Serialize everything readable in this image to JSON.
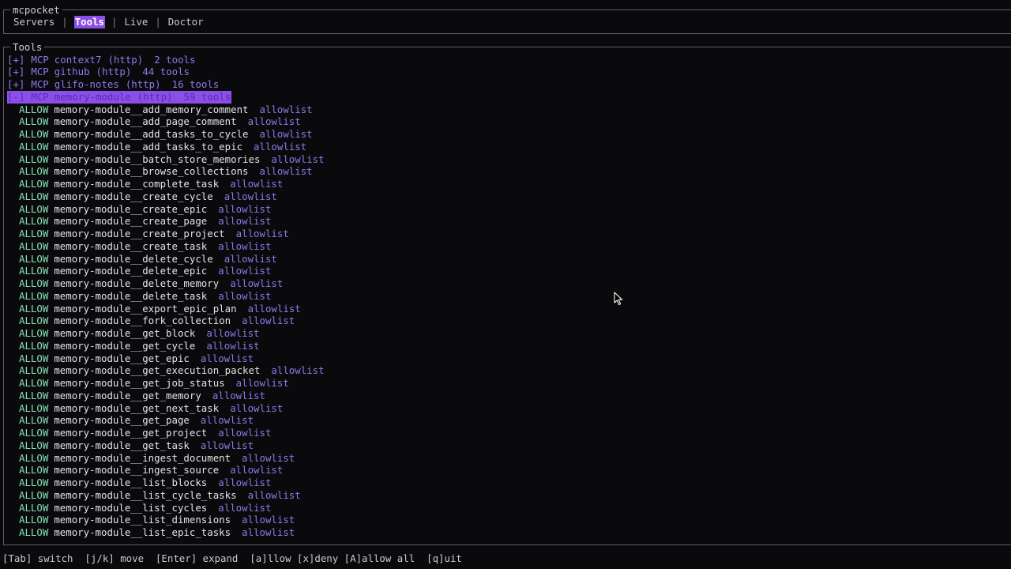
{
  "app": {
    "title": "mcpocket",
    "tabs": [
      {
        "label": "Servers",
        "active": false
      },
      {
        "label": "Tools",
        "active": true
      },
      {
        "label": "Live",
        "active": false
      },
      {
        "label": "Doctor",
        "active": false
      }
    ]
  },
  "panel": {
    "title": "Tools",
    "servers": [
      {
        "toggle": "[+]",
        "prefix": "MCP",
        "name": "context7",
        "kind": "(http)",
        "count": "2 tools"
      },
      {
        "toggle": "[+]",
        "prefix": "MCP",
        "name": "github",
        "kind": "(http)",
        "count": "44 tools"
      },
      {
        "toggle": "[+]",
        "prefix": "MCP",
        "name": "glifo-notes",
        "kind": "(http)",
        "count": "16 tools"
      },
      {
        "toggle": "[-]",
        "prefix": "MCP",
        "name": "memory-module",
        "kind": "(http)",
        "count": "59 tools",
        "selected": true
      }
    ],
    "tools": [
      {
        "status": "ALLOW",
        "name": "memory-module__add_memory_comment",
        "source": "allowlist"
      },
      {
        "status": "ALLOW",
        "name": "memory-module__add_page_comment",
        "source": "allowlist"
      },
      {
        "status": "ALLOW",
        "name": "memory-module__add_tasks_to_cycle",
        "source": "allowlist"
      },
      {
        "status": "ALLOW",
        "name": "memory-module__add_tasks_to_epic",
        "source": "allowlist"
      },
      {
        "status": "ALLOW",
        "name": "memory-module__batch_store_memories",
        "source": "allowlist"
      },
      {
        "status": "ALLOW",
        "name": "memory-module__browse_collections",
        "source": "allowlist"
      },
      {
        "status": "ALLOW",
        "name": "memory-module__complete_task",
        "source": "allowlist"
      },
      {
        "status": "ALLOW",
        "name": "memory-module__create_cycle",
        "source": "allowlist"
      },
      {
        "status": "ALLOW",
        "name": "memory-module__create_epic",
        "source": "allowlist"
      },
      {
        "status": "ALLOW",
        "name": "memory-module__create_page",
        "source": "allowlist"
      },
      {
        "status": "ALLOW",
        "name": "memory-module__create_project",
        "source": "allowlist"
      },
      {
        "status": "ALLOW",
        "name": "memory-module__create_task",
        "source": "allowlist"
      },
      {
        "status": "ALLOW",
        "name": "memory-module__delete_cycle",
        "source": "allowlist"
      },
      {
        "status": "ALLOW",
        "name": "memory-module__delete_epic",
        "source": "allowlist"
      },
      {
        "status": "ALLOW",
        "name": "memory-module__delete_memory",
        "source": "allowlist"
      },
      {
        "status": "ALLOW",
        "name": "memory-module__delete_task",
        "source": "allowlist"
      },
      {
        "status": "ALLOW",
        "name": "memory-module__export_epic_plan",
        "source": "allowlist"
      },
      {
        "status": "ALLOW",
        "name": "memory-module__fork_collection",
        "source": "allowlist"
      },
      {
        "status": "ALLOW",
        "name": "memory-module__get_block",
        "source": "allowlist"
      },
      {
        "status": "ALLOW",
        "name": "memory-module__get_cycle",
        "source": "allowlist"
      },
      {
        "status": "ALLOW",
        "name": "memory-module__get_epic",
        "source": "allowlist"
      },
      {
        "status": "ALLOW",
        "name": "memory-module__get_execution_packet",
        "source": "allowlist"
      },
      {
        "status": "ALLOW",
        "name": "memory-module__get_job_status",
        "source": "allowlist"
      },
      {
        "status": "ALLOW",
        "name": "memory-module__get_memory",
        "source": "allowlist"
      },
      {
        "status": "ALLOW",
        "name": "memory-module__get_next_task",
        "source": "allowlist"
      },
      {
        "status": "ALLOW",
        "name": "memory-module__get_page",
        "source": "allowlist"
      },
      {
        "status": "ALLOW",
        "name": "memory-module__get_project",
        "source": "allowlist"
      },
      {
        "status": "ALLOW",
        "name": "memory-module__get_task",
        "source": "allowlist"
      },
      {
        "status": "ALLOW",
        "name": "memory-module__ingest_document",
        "source": "allowlist"
      },
      {
        "status": "ALLOW",
        "name": "memory-module__ingest_source",
        "source": "allowlist"
      },
      {
        "status": "ALLOW",
        "name": "memory-module__list_blocks",
        "source": "allowlist"
      },
      {
        "status": "ALLOW",
        "name": "memory-module__list_cycle_tasks",
        "source": "allowlist"
      },
      {
        "status": "ALLOW",
        "name": "memory-module__list_cycles",
        "source": "allowlist"
      },
      {
        "status": "ALLOW",
        "name": "memory-module__list_dimensions",
        "source": "allowlist"
      },
      {
        "status": "ALLOW",
        "name": "memory-module__list_epic_tasks",
        "source": "allowlist"
      }
    ]
  },
  "footer": {
    "help": "[Tab] switch  [j/k] move  [Enter] expand  [a]llow [x]deny [A]allow all  [q]uit"
  },
  "colors": {
    "accent": "#8b4fe8",
    "allow": "#86e0b4",
    "muted_purple": "#8e78e8",
    "background": "#0a0a0c"
  }
}
